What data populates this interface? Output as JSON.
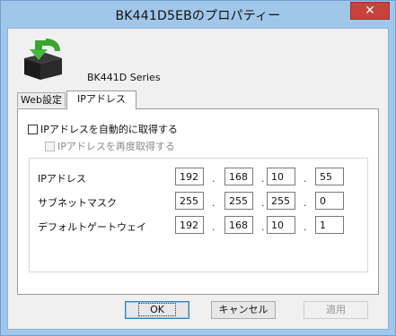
{
  "window": {
    "title": "BK441D5EBのプロパティー",
    "close_label": "✕"
  },
  "device": {
    "icon": "printer-install-icon",
    "model": "BK441D Series"
  },
  "tabs": [
    {
      "label": "Web設定",
      "active": false
    },
    {
      "label": "IPアドレス",
      "active": true
    }
  ],
  "ip_panel": {
    "auto_obtain": {
      "label": "IPアドレスを自動的に取得する",
      "checked": false
    },
    "reobtain": {
      "label": "IPアドレスを再度取得する",
      "checked": false,
      "disabled": true
    },
    "fields": [
      {
        "label": "IPアドレス",
        "octets": [
          "192",
          "168",
          "10",
          "55"
        ]
      },
      {
        "label": "サブネットマスク",
        "octets": [
          "255",
          "255",
          "255",
          "0"
        ]
      },
      {
        "label": "デフォルトゲートウェイ",
        "octets": [
          "192",
          "168",
          "10",
          "1"
        ]
      }
    ],
    "separator": "."
  },
  "buttons": {
    "ok": "OK",
    "cancel": "キャンセル",
    "apply": "適用"
  },
  "colors": {
    "frame": "#a0c7e9",
    "close": "#c8413a",
    "arrow": "#3aa531"
  }
}
